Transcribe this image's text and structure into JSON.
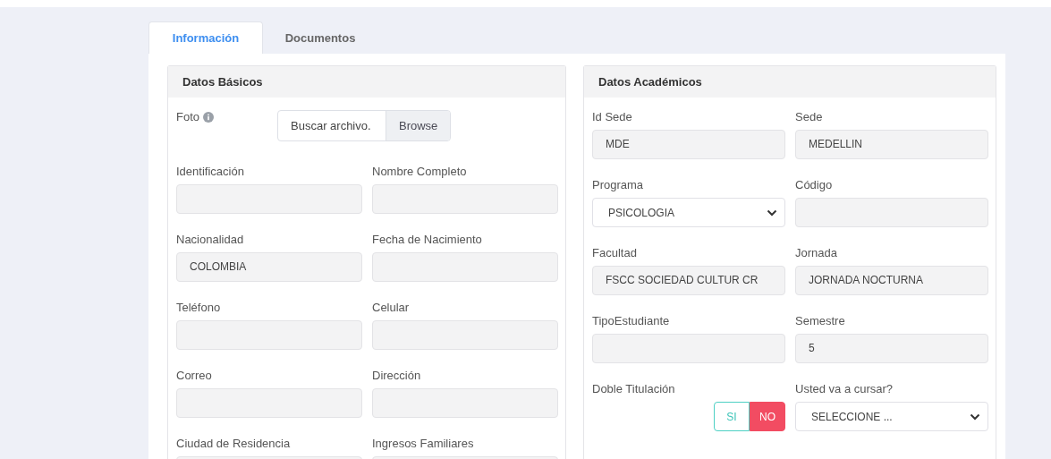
{
  "tabs": [
    {
      "label": "Información",
      "selected": true
    },
    {
      "label": "Documentos",
      "selected": false
    }
  ],
  "cards": [
    {
      "title": "Datos Básicos",
      "fields": [
        {
          "kind": "file",
          "label": "Foto",
          "value": "Buscar archivo.",
          "button": "Browse"
        },
        {
          "kind": "input",
          "label": "Identificación"
        },
        {
          "kind": "input",
          "label": "Nombre Completo"
        },
        {
          "kind": "input",
          "label": "Nacionalidad",
          "value": "COLOMBIA"
        },
        {
          "kind": "input",
          "label": "Fecha de Nacimiento"
        },
        {
          "kind": "input",
          "label": "Teléfono"
        },
        {
          "kind": "input",
          "label": "Celular"
        },
        {
          "kind": "input",
          "label": "Correo"
        },
        {
          "kind": "input",
          "label": "Dirección"
        },
        {
          "kind": "input",
          "label": "Ciudad de Residencia"
        },
        {
          "kind": "input",
          "label": "Ingresos Familiares"
        }
      ]
    },
    {
      "title": "Datos Académicos",
      "fields": [
        {
          "kind": "input",
          "label": "Id Sede",
          "value": "MDE"
        },
        {
          "kind": "input",
          "label": "Sede",
          "value": "MEDELLIN"
        },
        {
          "kind": "select",
          "label": "Programa",
          "value": "PSICOLOGIA"
        },
        {
          "kind": "input",
          "label": "Código"
        },
        {
          "kind": "input",
          "label": "Facultad",
          "value": "FSCC SOCIEDAD CULTUR CR"
        },
        {
          "kind": "input",
          "label": "Jornada",
          "value": "JORNADA NOCTURNA"
        },
        {
          "kind": "input",
          "label": "TipoEstudiante"
        },
        {
          "kind": "input",
          "label": "Semestre",
          "value": "5"
        },
        {
          "kind": "toggle",
          "label": "Doble Titulación",
          "options": [
            {
              "label": "SI",
              "selected": false
            },
            {
              "label": "NO",
              "selected": true
            }
          ]
        },
        {
          "kind": "select",
          "label": "Usted va a cursar?",
          "value": "SELECCIONE ..."
        }
      ]
    }
  ]
}
